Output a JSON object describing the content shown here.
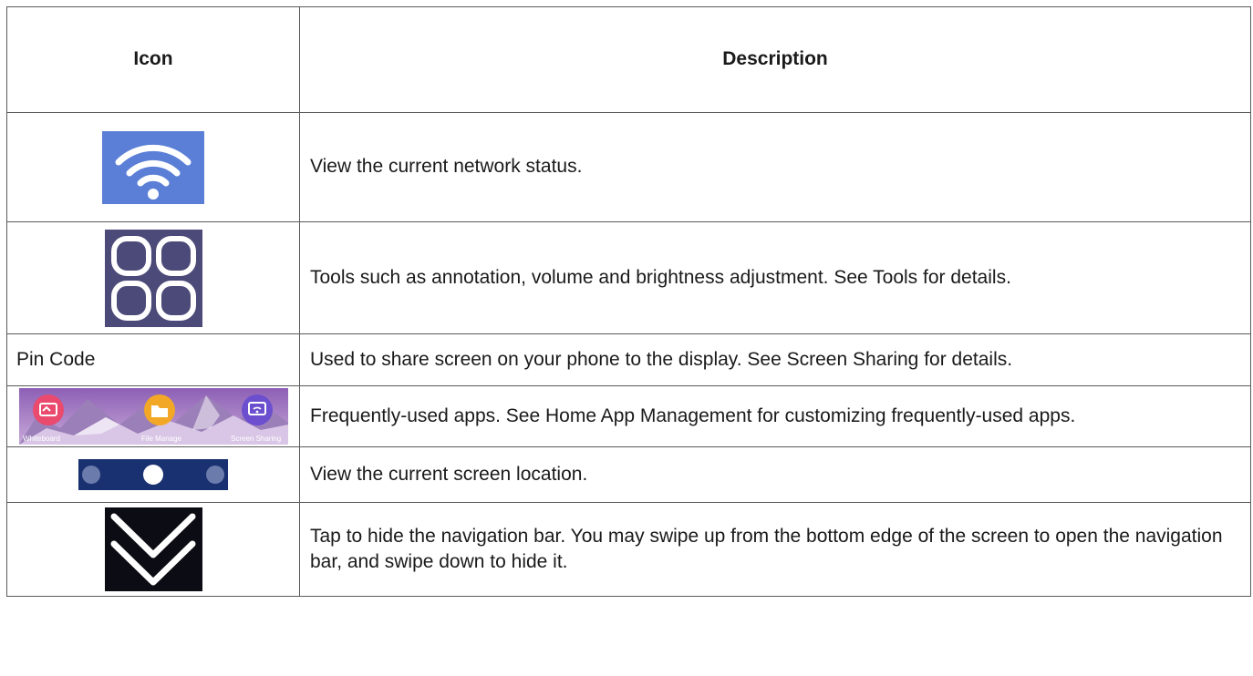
{
  "table": {
    "headers": {
      "icon": "Icon",
      "description": "Description"
    },
    "rows": [
      {
        "icon": "wifi-icon",
        "icon_color": "#5b7fd6",
        "description": "View the current network status."
      },
      {
        "icon": "tools-grid-icon",
        "icon_color": "#4b4a78",
        "description": "Tools such as annotation, volume and brightness adjustment. See Tools for details."
      },
      {
        "icon_text": "Pin Code",
        "description": "Used to share screen on your phone to the display. See Screen Sharing for details."
      },
      {
        "icon": "frequent-apps-strip",
        "apps": [
          "Whiteboard",
          "File Manage",
          "Screen Sharing"
        ],
        "description": "Frequently-used apps. See Home App Management for customizing frequently-used apps."
      },
      {
        "icon": "page-indicator-dots-icon",
        "icon_color": "#1f3e8a",
        "description": "View the current screen location."
      },
      {
        "icon": "chevron-down-double-icon",
        "icon_color": "#0c0c14",
        "description": "Tap to hide the navigation bar. You may swipe up from the bottom edge of the screen to open the navigation bar, and swipe down to hide it."
      }
    ]
  }
}
